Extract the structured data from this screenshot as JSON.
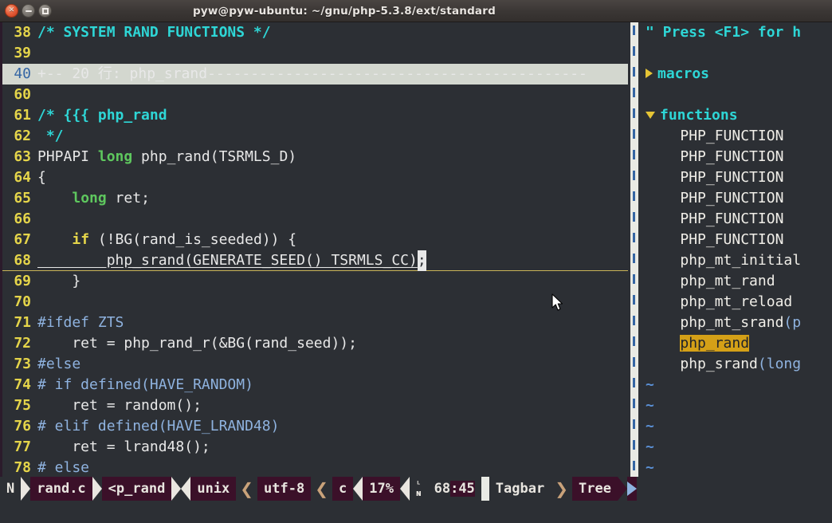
{
  "window": {
    "title": "pyw@pyw-ubuntu: ~/gnu/php-5.3.8/ext/standard",
    "controls": {
      "close": "×",
      "minimize": "−",
      "maximize": "□"
    }
  },
  "editor": {
    "lines": [
      {
        "num": "38",
        "segments": [
          {
            "text": "/* SYSTEM RAND FUNCTIONS */",
            "cls": "c-comment"
          }
        ]
      },
      {
        "num": "39",
        "segments": [
          {
            "text": "",
            "cls": "c-plain"
          }
        ]
      },
      {
        "num": "40",
        "fold": true,
        "segments": [
          {
            "text": "+-- 20 行: php_srand--------------------------------------------",
            "cls": "c-plain"
          }
        ]
      },
      {
        "num": "60",
        "segments": [
          {
            "text": "",
            "cls": "c-plain"
          }
        ]
      },
      {
        "num": "61",
        "segments": [
          {
            "text": "/* {{{ php_rand",
            "cls": "c-comment"
          }
        ]
      },
      {
        "num": "62",
        "segments": [
          {
            "text": " */",
            "cls": "c-comment"
          }
        ]
      },
      {
        "num": "63",
        "segments": [
          {
            "text": "PHPAPI ",
            "cls": "c-plain"
          },
          {
            "text": "long",
            "cls": "c-type"
          },
          {
            "text": " php_rand(TSRMLS_D)",
            "cls": "c-plain"
          }
        ]
      },
      {
        "num": "64",
        "segments": [
          {
            "text": "{",
            "cls": "c-plain"
          }
        ]
      },
      {
        "num": "65",
        "segments": [
          {
            "text": "    ",
            "cls": "c-plain"
          },
          {
            "text": "long",
            "cls": "c-type"
          },
          {
            "text": " ret;",
            "cls": "c-plain"
          }
        ]
      },
      {
        "num": "66",
        "segments": [
          {
            "text": "",
            "cls": "c-plain"
          }
        ]
      },
      {
        "num": "67",
        "segments": [
          {
            "text": "    ",
            "cls": "c-plain"
          },
          {
            "text": "if",
            "cls": "c-kw"
          },
          {
            "text": " (!BG(rand_is_seeded)) {",
            "cls": "c-plain"
          }
        ]
      },
      {
        "num": "68",
        "cursorline": true,
        "segments": [
          {
            "text": "        php_srand(GENERATE_SEED() TSRMLS_CC)",
            "cls": "c-plain"
          },
          {
            "text": ";",
            "cls": "cursor"
          }
        ]
      },
      {
        "num": "69",
        "segments": [
          {
            "text": "    }",
            "cls": "c-plain"
          }
        ]
      },
      {
        "num": "70",
        "segments": [
          {
            "text": "",
            "cls": "c-plain"
          }
        ]
      },
      {
        "num": "71",
        "segments": [
          {
            "text": "#ifdef ZTS",
            "cls": "c-pre"
          }
        ]
      },
      {
        "num": "72",
        "segments": [
          {
            "text": "    ret = php_rand_r(&BG(rand_seed));",
            "cls": "c-plain"
          }
        ]
      },
      {
        "num": "73",
        "segments": [
          {
            "text": "#else",
            "cls": "c-pre"
          }
        ]
      },
      {
        "num": "74",
        "segments": [
          {
            "text": "# if defined(HAVE_RANDOM)",
            "cls": "c-pre"
          }
        ]
      },
      {
        "num": "75",
        "segments": [
          {
            "text": "    ret = random();",
            "cls": "c-plain"
          }
        ]
      },
      {
        "num": "76",
        "segments": [
          {
            "text": "# elif defined(HAVE_LRAND48)",
            "cls": "c-pre"
          }
        ]
      },
      {
        "num": "77",
        "segments": [
          {
            "text": "    ret = lrand48();",
            "cls": "c-plain"
          }
        ]
      },
      {
        "num": "78",
        "segments": [
          {
            "text": "# else",
            "cls": "c-pre"
          }
        ]
      }
    ]
  },
  "tagbar": {
    "lines": [
      {
        "kind": "help",
        "text": "\" Press <F1> for h"
      },
      {
        "kind": "blank",
        "text": ""
      },
      {
        "kind": "section",
        "icon": "triangle-right-icon",
        "text": "macros"
      },
      {
        "kind": "blank",
        "text": ""
      },
      {
        "kind": "section",
        "icon": "triangle-down-icon",
        "text": "functions"
      },
      {
        "kind": "tag",
        "name": "PHP_FUNCTION",
        "sig": ""
      },
      {
        "kind": "tag",
        "name": "PHP_FUNCTION",
        "sig": ""
      },
      {
        "kind": "tag",
        "name": "PHP_FUNCTION",
        "sig": ""
      },
      {
        "kind": "tag",
        "name": "PHP_FUNCTION",
        "sig": ""
      },
      {
        "kind": "tag",
        "name": "PHP_FUNCTION",
        "sig": ""
      },
      {
        "kind": "tag",
        "name": "PHP_FUNCTION",
        "sig": ""
      },
      {
        "kind": "tag",
        "name": "php_mt_initial",
        "sig": ""
      },
      {
        "kind": "tag",
        "name": "php_mt_rand",
        "sig": ""
      },
      {
        "kind": "tag",
        "name": "php_mt_reload",
        "sig": ""
      },
      {
        "kind": "tag",
        "name": "php_mt_srand",
        "sig": "(p"
      },
      {
        "kind": "tag",
        "name": "php_rand",
        "sig": "",
        "highlight": true
      },
      {
        "kind": "tag",
        "name": "php_srand",
        "sig": "(long"
      },
      {
        "kind": "tilde",
        "text": "~"
      },
      {
        "kind": "tilde",
        "text": "~"
      },
      {
        "kind": "tilde",
        "text": "~"
      },
      {
        "kind": "tilde",
        "text": "~"
      },
      {
        "kind": "tilde",
        "text": "~"
      }
    ]
  },
  "statusline": {
    "mode": "N",
    "filename": "rand.c",
    "branch": "<p_rand",
    "fileformat": "unix",
    "encoding": "utf-8",
    "filetype": "c",
    "percent": "17%",
    "linecol": "68:45",
    "linecol_line": "68",
    "linecol_col": ":45",
    "right_left": "Tagbar",
    "right_right": "Tree"
  },
  "colors": {
    "accent_yellow": "#e5d54a",
    "accent_cyan": "#2ed6d6",
    "accent_green": "#5ec75e",
    "accent_blue": "#8fb3e0",
    "highlight_gold": "#d4a017",
    "fold_bg": "#d3d7cf",
    "bg": "#2c2f34",
    "status_plum": "#3b1029"
  }
}
